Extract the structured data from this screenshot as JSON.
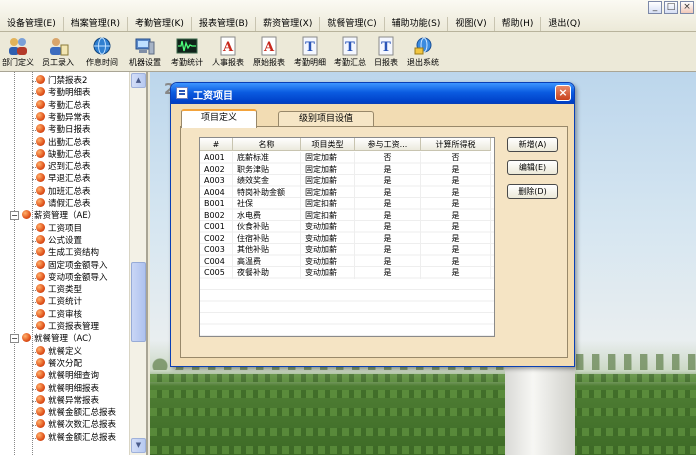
{
  "menu": {
    "items": [
      "设备管理(E)",
      "档案管理(R)",
      "考勤管理(K)",
      "报表管理(B)",
      "薪资管理(X)",
      "就餐管理(C)",
      "辅助功能(S)",
      "视图(V)",
      "帮助(H)",
      "退出(Q)"
    ]
  },
  "window_controls": [
    "_",
    "□",
    "×"
  ],
  "toolbar": {
    "buttons": [
      {
        "label": "部门定义",
        "icon": "people-group-icon"
      },
      {
        "label": "员工录入",
        "icon": "employee-card-icon"
      },
      {
        "label": "作息时间",
        "icon": "globe-clock-icon"
      },
      {
        "label": "机器设置",
        "icon": "computer-device-icon"
      },
      {
        "label": "考勤统计",
        "icon": "waveform-monitor-icon"
      },
      {
        "label": "人事报表",
        "icon": "report-a-icon"
      },
      {
        "label": "原始报表",
        "icon": "report-a-icon"
      },
      {
        "label": "考勤明细",
        "icon": "report-t-icon"
      },
      {
        "label": "考勤汇总",
        "icon": "report-t-icon"
      },
      {
        "label": "日报表",
        "icon": "report-t-icon"
      },
      {
        "label": "退出系统",
        "icon": "exit-globe-icon"
      }
    ]
  },
  "tree": {
    "items": [
      {
        "label": "门禁报表2",
        "level": 2
      },
      {
        "label": "考勤明细表",
        "level": 2
      },
      {
        "label": "考勤汇总表",
        "level": 2
      },
      {
        "label": "考勤异常表",
        "level": 2
      },
      {
        "label": "考勤日报表",
        "level": 2
      },
      {
        "label": "出勤汇总表",
        "level": 2
      },
      {
        "label": "缺勤汇总表",
        "level": 2
      },
      {
        "label": "迟到汇总表",
        "level": 2
      },
      {
        "label": "早退汇总表",
        "level": 2
      },
      {
        "label": "加班汇总表",
        "level": 2
      },
      {
        "label": "请假汇总表",
        "level": 2
      },
      {
        "label": "薪资管理（AE）",
        "level": 1
      },
      {
        "label": "工资项目",
        "level": 2
      },
      {
        "label": "公式设置",
        "level": 2
      },
      {
        "label": "生成工资结构",
        "level": 2
      },
      {
        "label": "固定项金额导入",
        "level": 2
      },
      {
        "label": "变动项金额导入",
        "level": 2
      },
      {
        "label": "工资类型",
        "level": 2
      },
      {
        "label": "工资统计",
        "level": 2
      },
      {
        "label": "工资审核",
        "level": 2
      },
      {
        "label": "工资报表管理",
        "level": 2
      },
      {
        "label": "就餐管理（AC）",
        "level": 1
      },
      {
        "label": "就餐定义",
        "level": 2
      },
      {
        "label": "餐次分配",
        "level": 2
      },
      {
        "label": "就餐明细查询",
        "level": 2
      },
      {
        "label": "就餐明细报表",
        "level": 2
      },
      {
        "label": "就餐异常报表",
        "level": 2
      },
      {
        "label": "就餐金额汇总报表",
        "level": 2
      },
      {
        "label": "就餐次数汇总报表",
        "level": 2
      },
      {
        "label": "就餐金额汇总报表",
        "level": 2
      }
    ]
  },
  "scene": {
    "number": "2"
  },
  "dialog": {
    "title": "工资项目",
    "close": "×",
    "tabs": [
      "项目定义",
      "级别项目设值"
    ],
    "table": {
      "columns": [
        "#",
        "名称",
        "项目类型",
        "参与工资...",
        "计算所得税"
      ],
      "rows": [
        [
          "A001",
          "底薪标准",
          "固定加薪",
          "否",
          "否"
        ],
        [
          "A002",
          "职务津贴",
          "固定加薪",
          "是",
          "是"
        ],
        [
          "A003",
          "绩效奖金",
          "固定加薪",
          "是",
          "是"
        ],
        [
          "A004",
          "特岗补助金额",
          "固定加薪",
          "是",
          "是"
        ],
        [
          "B001",
          "社保",
          "固定扣薪",
          "是",
          "是"
        ],
        [
          "B002",
          "水电费",
          "固定扣薪",
          "是",
          "是"
        ],
        [
          "C001",
          "伙食补贴",
          "变动加薪",
          "是",
          "是"
        ],
        [
          "C002",
          "住宿补贴",
          "变动加薪",
          "是",
          "是"
        ],
        [
          "C003",
          "其他补贴",
          "变动加薪",
          "是",
          "是"
        ],
        [
          "C004",
          "高温费",
          "变动加薪",
          "是",
          "是"
        ],
        [
          "C005",
          "夜餐补助",
          "变动加薪",
          "是",
          "是"
        ]
      ]
    },
    "buttons": {
      "add": "新增(A)",
      "edit": "编辑(E)",
      "delete": "删除(D)"
    }
  }
}
